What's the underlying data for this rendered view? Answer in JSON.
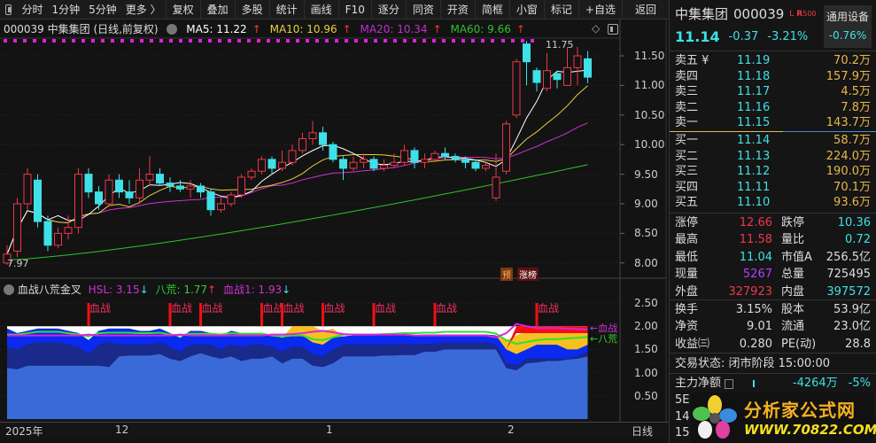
{
  "toolbar": {
    "left": [
      "分时",
      "1分钟",
      "5分钟",
      "更多 〉"
    ],
    "buttons": [
      "复权",
      "叠加",
      "多股",
      "统计",
      "画线",
      "F10",
      "逐分",
      "同资",
      "开资",
      "简框",
      "小窗",
      "标记",
      "+自选"
    ],
    "back": "返回"
  },
  "chart_header": {
    "code_name": "000039 中集集团 (日线,前复权)",
    "ma5": "MA5: 11.22",
    "ma10": "MA10: 10.96",
    "ma20": "MA20: 10.34",
    "ma60": "MA60: 9.66"
  },
  "price_axis": [
    "11.50",
    "11.00",
    "10.50",
    "10.00",
    "9.50",
    "9.00",
    "8.50",
    "8.00"
  ],
  "annotations": {
    "high": "11.75",
    "low": "7.97",
    "tag1": "预",
    "tag2": "涨榜"
  },
  "indicator": {
    "name": "血战八荒金叉",
    "hsl": "HSL: 3.15",
    "bahuang": "八荒: 1.77",
    "xuezhan1": "血战1: 1.93",
    "signal_label": "血战",
    "axis": [
      "2.50",
      "2.00",
      "1.50",
      "1.00",
      "0.50"
    ],
    "right_labels": [
      "←血战",
      "←八荒"
    ],
    "signal_indices": [
      8,
      16,
      19,
      25,
      27,
      31,
      36,
      42,
      52
    ],
    "base": [
      1.1,
      1.07,
      1.15,
      1.15,
      1.15,
      1.15,
      1.15,
      1.15,
      1.15,
      1.15,
      1.12,
      1.35,
      1.37,
      1.37,
      1.37,
      1.4,
      1.3,
      1.25,
      1.35,
      1.42,
      1.35,
      1.3,
      1.35,
      1.25,
      1.3,
      1.3,
      1.35,
      1.2,
      1.3,
      1.3,
      1.15,
      1.12,
      1.2,
      1.35,
      1.35,
      1.35,
      1.35,
      1.37,
      1.37,
      1.38,
      1.38,
      1.45,
      1.45,
      1.5,
      1.5,
      1.5,
      1.5,
      1.5,
      1.5,
      1.1,
      1.05,
      1.2,
      1.22,
      1.25,
      1.25,
      1.28,
      1.3,
      1.35
    ],
    "navy": [
      1.55,
      1.5,
      1.6,
      1.65,
      1.65,
      1.65,
      1.6,
      1.55,
      1.4,
      1.6,
      1.65,
      1.6,
      1.6,
      1.6,
      1.6,
      1.65,
      1.55,
      1.45,
      1.6,
      1.6,
      1.6,
      1.5,
      1.6,
      1.55,
      1.6,
      1.6,
      1.55,
      1.45,
      1.55,
      1.55,
      1.4,
      1.35,
      1.5,
      1.6,
      1.6,
      1.6,
      1.6,
      1.6,
      1.6,
      1.62,
      1.6,
      1.62,
      1.62,
      1.65,
      1.65,
      1.65,
      1.65,
      1.65,
      1.6,
      1.2,
      1.15,
      1.3,
      1.3,
      1.3,
      1.3,
      1.3,
      1.35,
      1.45
    ],
    "blue": [
      1.95,
      1.85,
      1.9,
      1.95,
      1.95,
      1.95,
      1.9,
      1.85,
      1.7,
      1.9,
      1.95,
      1.95,
      1.95,
      1.9,
      1.9,
      1.95,
      1.85,
      1.75,
      1.9,
      1.9,
      1.85,
      1.8,
      1.9,
      1.85,
      1.85,
      1.85,
      1.8,
      1.75,
      1.8,
      1.8,
      1.65,
      1.6,
      1.75,
      1.78,
      1.8,
      1.8,
      1.8,
      1.8,
      1.8,
      1.8,
      1.8,
      1.82,
      1.82,
      1.82,
      1.82,
      1.82,
      1.82,
      1.82,
      1.8,
      1.5,
      1.4,
      1.5,
      1.6,
      1.6,
      1.6,
      1.5,
      1.5,
      1.6
    ],
    "green": [
      1.82,
      1.82,
      1.85,
      1.88,
      1.88,
      1.88,
      1.85,
      1.82,
      1.78,
      1.85,
      1.86,
      1.86,
      1.86,
      1.85,
      1.85,
      1.86,
      1.82,
      1.8,
      1.84,
      1.84,
      1.84,
      1.82,
      1.85,
      1.84,
      1.84,
      1.84,
      1.8,
      1.78,
      1.8,
      1.8,
      1.72,
      1.7,
      1.76,
      1.82,
      1.82,
      1.82,
      1.82,
      1.83,
      1.84,
      1.85,
      1.85,
      1.86,
      1.86,
      1.88,
      1.88,
      1.88,
      1.88,
      1.88,
      1.84,
      1.7,
      1.62,
      1.66,
      1.7,
      1.72,
      1.72,
      1.74,
      1.75,
      1.77
    ],
    "magenta": [
      1.8,
      1.8,
      1.8,
      1.8,
      1.8,
      1.8,
      1.8,
      1.8,
      1.82,
      1.8,
      1.8,
      1.8,
      1.8,
      1.8,
      1.8,
      1.8,
      1.8,
      1.82,
      1.8,
      1.8,
      1.8,
      1.8,
      1.8,
      1.8,
      1.8,
      1.8,
      1.82,
      1.82,
      1.83,
      1.85,
      1.88,
      1.9,
      1.87,
      1.83,
      1.82,
      1.82,
      1.82,
      1.82,
      1.82,
      1.82,
      1.8,
      1.8,
      1.8,
      1.8,
      1.8,
      1.8,
      1.8,
      1.8,
      1.76,
      1.85,
      2.05,
      2.0,
      1.96,
      1.96,
      1.96,
      1.95,
      1.94,
      1.93
    ],
    "hot": [
      0,
      0,
      0,
      0,
      0,
      0,
      0,
      0,
      0,
      0,
      0,
      0,
      0,
      0,
      0,
      0,
      0,
      0,
      0,
      0,
      0,
      0,
      0,
      0,
      0,
      0,
      0,
      0,
      0.1,
      0.2,
      0.25,
      0.2,
      0.1,
      0,
      0,
      0,
      0,
      0,
      0,
      0,
      0,
      0,
      0,
      0,
      0,
      0,
      0,
      0,
      0,
      0.1,
      0.3,
      0.3,
      0.3,
      0.28,
      0.28,
      0.26,
      0.25,
      0.25
    ]
  },
  "date_axis": [
    "2025年",
    "12",
    "1",
    "2"
  ],
  "period": "日线",
  "quote": {
    "name": "中集集团",
    "code": "000039",
    "badge_l": "L",
    "badge_r": "R",
    "badge_500": "500",
    "sector": "通用设备",
    "sector_change": "-0.76%",
    "price": "11.14",
    "change": "-0.37",
    "pct": "-3.21%"
  },
  "order_book": {
    "asks": [
      {
        "label": "卖五 ¥",
        "price": "11.19",
        "vol": "70.2万"
      },
      {
        "label": "卖四",
        "price": "11.18",
        "vol": "157.9万"
      },
      {
        "label": "卖三",
        "price": "11.17",
        "vol": "4.5万"
      },
      {
        "label": "卖二",
        "price": "11.16",
        "vol": "7.8万"
      },
      {
        "label": "卖一",
        "price": "11.15",
        "vol": "143.7万"
      }
    ],
    "bids": [
      {
        "label": "买一",
        "price": "11.14",
        "vol": "58.7万"
      },
      {
        "label": "买二",
        "price": "11.13",
        "vol": "224.0万"
      },
      {
        "label": "买三",
        "price": "11.12",
        "vol": "190.0万"
      },
      {
        "label": "买四",
        "price": "11.11",
        "vol": "70.1万"
      },
      {
        "label": "买五",
        "price": "11.10",
        "vol": "93.6万"
      }
    ]
  },
  "stats": [
    [
      "涨停",
      "12.66",
      "跌停",
      "10.36"
    ],
    [
      "最高",
      "11.58",
      "量比",
      "0.72"
    ],
    [
      "最低",
      "11.04",
      "市值A",
      "256.5亿"
    ],
    [
      "现量",
      "5267",
      "总量",
      "725495"
    ],
    [
      "外盘",
      "327923",
      "内盘",
      "397572"
    ],
    [
      "换手",
      "3.15%",
      "股本",
      "53.9亿"
    ],
    [
      "净资",
      "9.01",
      "流通",
      "23.0亿"
    ],
    [
      "收益㈢",
      "0.280",
      "PE(动)",
      "28.8"
    ]
  ],
  "trade_status": "交易状态: 闭市阶段 15:00:00",
  "main_flow": {
    "label": "主力净额",
    "value": "-4264万",
    "pct": "-5%"
  },
  "partial_rows": [
    "5E",
    "14:",
    "15:"
  ],
  "logo": {
    "title": "分析家公式网",
    "url": "WWW.70822.COM"
  },
  "chart_data": {
    "type": "candlestick",
    "title": "000039 中集集团 (日线,前复权)",
    "ylim": [
      7.9,
      11.8
    ],
    "ohlc": [
      [
        8.0,
        8.15,
        8.3,
        7.97
      ],
      [
        8.2,
        9.0,
        9.1,
        8.1
      ],
      [
        9.0,
        9.5,
        9.6,
        8.9
      ],
      [
        9.4,
        8.7,
        9.5,
        8.6
      ],
      [
        8.7,
        8.3,
        8.8,
        8.2
      ],
      [
        8.3,
        8.5,
        8.6,
        8.25
      ],
      [
        8.5,
        8.6,
        8.8,
        8.4
      ],
      [
        8.6,
        9.5,
        9.6,
        8.5
      ],
      [
        9.5,
        9.2,
        9.6,
        9.1
      ],
      [
        9.2,
        9.0,
        9.3,
        8.9
      ],
      [
        9.0,
        9.4,
        9.5,
        8.95
      ],
      [
        9.4,
        9.2,
        9.5,
        9.1
      ],
      [
        9.2,
        9.1,
        9.4,
        9.0
      ],
      [
        9.1,
        9.4,
        9.6,
        9.0
      ],
      [
        9.4,
        9.5,
        9.8,
        9.3
      ],
      [
        9.5,
        9.35,
        9.6,
        9.3
      ],
      [
        9.35,
        9.3,
        9.45,
        9.2
      ],
      [
        9.3,
        9.25,
        9.4,
        9.2
      ],
      [
        9.25,
        9.3,
        9.4,
        9.1
      ],
      [
        9.3,
        9.2,
        9.35,
        9.1
      ],
      [
        9.2,
        8.9,
        9.25,
        8.8
      ],
      [
        8.9,
        9.0,
        9.1,
        8.85
      ],
      [
        9.0,
        9.15,
        9.2,
        8.95
      ],
      [
        9.15,
        9.45,
        9.5,
        9.1
      ],
      [
        9.45,
        9.55,
        9.6,
        9.4
      ],
      [
        9.55,
        9.75,
        9.8,
        9.5
      ],
      [
        9.75,
        9.6,
        9.8,
        9.5
      ],
      [
        9.6,
        9.7,
        9.9,
        9.55
      ],
      [
        9.7,
        9.9,
        10.0,
        9.65
      ],
      [
        9.9,
        10.1,
        10.2,
        9.85
      ],
      [
        10.1,
        10.2,
        10.4,
        10.0
      ],
      [
        10.2,
        10.0,
        10.3,
        9.9
      ],
      [
        10.0,
        9.75,
        10.05,
        9.7
      ],
      [
        9.75,
        9.6,
        9.8,
        9.4
      ],
      [
        9.6,
        9.7,
        9.8,
        9.55
      ],
      [
        9.7,
        9.75,
        9.85,
        9.6
      ],
      [
        9.75,
        9.6,
        9.8,
        9.55
      ],
      [
        9.6,
        9.65,
        9.75,
        9.55
      ],
      [
        9.65,
        9.7,
        9.85,
        9.6
      ],
      [
        9.7,
        9.9,
        10.0,
        9.65
      ],
      [
        9.9,
        9.7,
        9.95,
        9.6
      ],
      [
        9.7,
        9.75,
        9.85,
        9.6
      ],
      [
        9.75,
        9.85,
        9.9,
        9.7
      ],
      [
        9.85,
        9.8,
        9.95,
        9.75
      ],
      [
        9.8,
        9.75,
        9.85,
        9.7
      ],
      [
        9.75,
        9.7,
        9.8,
        9.6
      ],
      [
        9.7,
        9.6,
        9.75,
        9.55
      ],
      [
        9.6,
        9.65,
        9.7,
        9.55
      ],
      [
        9.1,
        9.45,
        9.85,
        9.05
      ],
      [
        9.55,
        10.35,
        10.4,
        9.5
      ],
      [
        10.5,
        11.4,
        11.45,
        10.45
      ],
      [
        11.7,
        11.4,
        11.75,
        11.0
      ],
      [
        11.25,
        11.05,
        11.3,
        10.9
      ],
      [
        10.95,
        11.25,
        11.55,
        10.9
      ],
      [
        11.2,
        11.1,
        11.25,
        10.95
      ],
      [
        11.0,
        11.3,
        11.65,
        11.0
      ],
      [
        11.3,
        11.5,
        11.65,
        11.0
      ],
      [
        11.45,
        11.14,
        11.58,
        11.04
      ]
    ],
    "ma60_range": [
      8.05,
      9.66
    ],
    "colors": {
      "up": "#f0364a",
      "down": "#3fe0e8",
      "ma5": "#ffffff",
      "ma10": "#e8d040",
      "ma20": "#d030d0",
      "ma60": "#30c030"
    }
  }
}
